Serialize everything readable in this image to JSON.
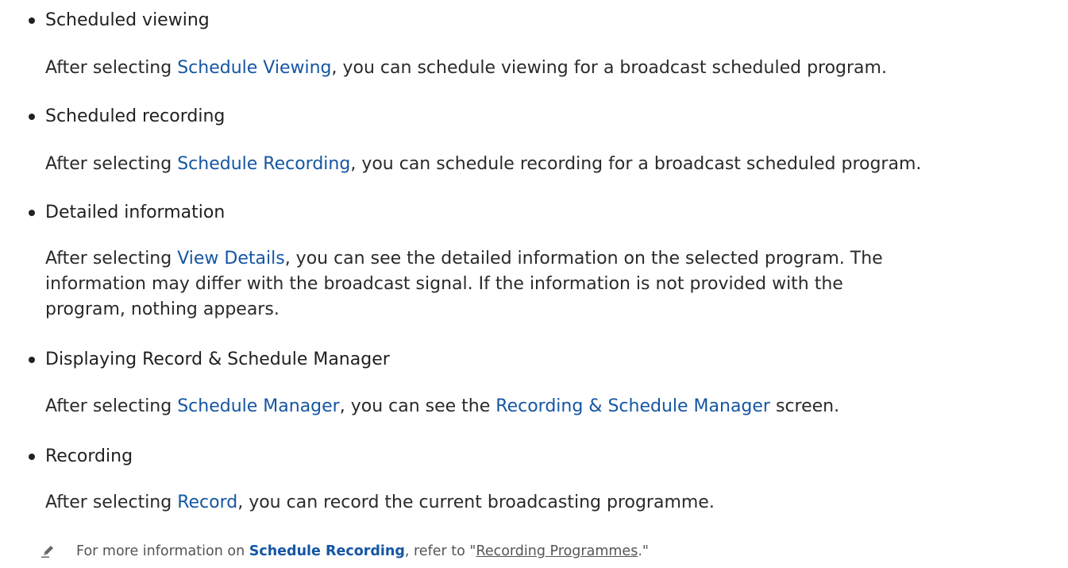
{
  "items": [
    {
      "title": "Scheduled viewing",
      "body": {
        "prefix": "After selecting ",
        "link": "Schedule Viewing",
        "suffix": ", you can schedule viewing for a broadcast scheduled program."
      }
    },
    {
      "title": "Scheduled recording",
      "body": {
        "prefix": "After selecting ",
        "link": "Schedule Recording",
        "suffix": ", you can schedule recording for a broadcast scheduled program."
      }
    },
    {
      "title": "Detailed information",
      "body": {
        "prefix": "After selecting ",
        "link": "View Details",
        "suffix": ", you can see the detailed information on the selected program. The information may differ with the broadcast signal. If the information is not provided with the program, nothing appears."
      }
    },
    {
      "title": "Displaying Record & Schedule Manager",
      "body": {
        "prefix": "After selecting ",
        "link": "Schedule Manager",
        "middle": ", you can see the ",
        "link2": "Recording & Schedule Manager",
        "suffix": " screen."
      }
    },
    {
      "title": "Recording",
      "body": {
        "prefix": "After selecting ",
        "link": "Record",
        "suffix": ", you can record the current broadcasting programme."
      }
    }
  ],
  "note": {
    "icon": "pencil-note-icon",
    "prefix": "For more information on ",
    "link": "Schedule Recording",
    "middle": ", refer to \"",
    "ref": "Recording Programmes",
    "suffix": ".\""
  },
  "colors": {
    "link": "#1556a3",
    "text": "#222222",
    "note_text": "#555555"
  }
}
